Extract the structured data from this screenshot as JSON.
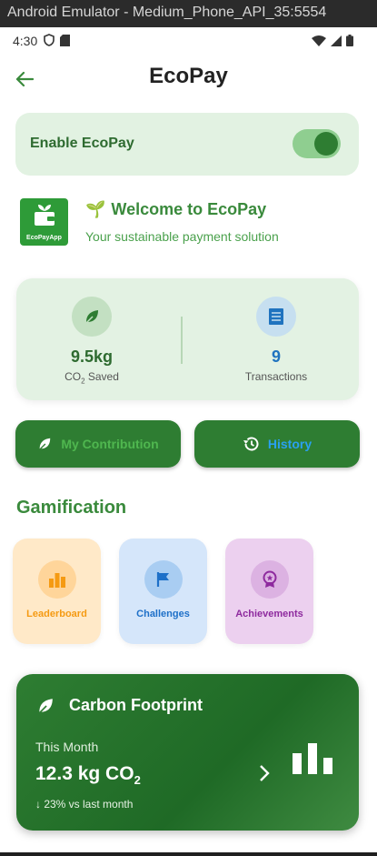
{
  "window": {
    "title": "Android Emulator - Medium_Phone_API_35:5554"
  },
  "status_bar": {
    "time": "4:30"
  },
  "header": {
    "title": "EcoPay"
  },
  "enable_card": {
    "label": "Enable EcoPay",
    "enabled": true
  },
  "welcome": {
    "logo_text": "EcoPayApp",
    "emoji": "🌱",
    "title": "Welcome to EcoPay",
    "subtitle": "Your sustainable payment solution"
  },
  "stats": {
    "co2": {
      "value": "9.5kg",
      "label_prefix": "CO",
      "label_sub": "2",
      "label_suffix": " Saved"
    },
    "transactions": {
      "value": "9",
      "label": "Transactions"
    }
  },
  "actions": {
    "contribution_label": "My Contribution",
    "history_label": "History"
  },
  "gamification": {
    "title": "Gamification",
    "items": [
      {
        "label": "Leaderboard",
        "icon": "leaderboard-icon"
      },
      {
        "label": "Challenges",
        "icon": "flag-icon"
      },
      {
        "label": "Achievements",
        "icon": "medal-icon"
      }
    ]
  },
  "carbon": {
    "title": "Carbon Footprint",
    "period": "This Month",
    "value_main": "12.3 kg CO",
    "value_sub": "2",
    "change": "↓ 23% vs last month"
  },
  "colors": {
    "primary_green": "#2e7d32",
    "light_green": "#e2f2e2",
    "history_blue": "#2aa0f0",
    "leaderboard_orange": "#f59a12",
    "challenges_blue": "#1e70c8",
    "achievements_purple": "#8e2a9e"
  }
}
